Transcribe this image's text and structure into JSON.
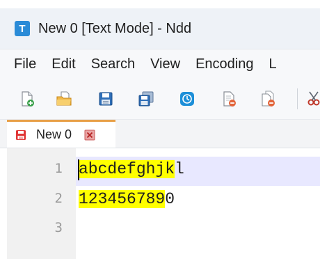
{
  "window": {
    "title": "New 0 [Text Mode] - Ndd",
    "app_icon_letter": "T",
    "app_icon_color": "#2a8bd7"
  },
  "menubar": {
    "items": [
      {
        "label": "File"
      },
      {
        "label": "Edit"
      },
      {
        "label": "Search"
      },
      {
        "label": "View"
      },
      {
        "label": "Encoding"
      },
      {
        "label": "L"
      }
    ]
  },
  "toolbar": {
    "buttons": [
      {
        "icon": "new-file-icon"
      },
      {
        "icon": "open-folder-icon"
      },
      {
        "icon": "save-icon"
      },
      {
        "icon": "save-all-icon"
      },
      {
        "icon": "auto-save-icon"
      },
      {
        "icon": "close-file-icon"
      },
      {
        "icon": "close-all-icon"
      },
      {
        "icon": "cut-icon"
      }
    ]
  },
  "tabs": [
    {
      "label": "New 0",
      "icon": "unsaved-file-icon",
      "close_icon": "tab-close-icon",
      "accent_color": "#e8a048"
    }
  ],
  "editor": {
    "current_line": 1,
    "highlight_color": "#ffff00",
    "lines": [
      {
        "number": "1",
        "highlighted": "abcdefghjk",
        "rest": "l"
      },
      {
        "number": "2",
        "highlighted": "123456789",
        "rest": "0"
      },
      {
        "number": "3",
        "highlighted": "",
        "rest": ""
      }
    ]
  }
}
